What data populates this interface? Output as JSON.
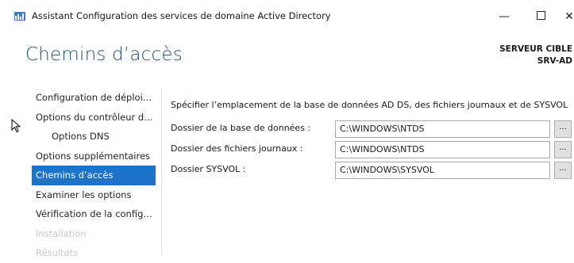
{
  "window": {
    "title": "Assistant Configuration des services de domaine Active Directory",
    "minimize": "—",
    "close": "✕"
  },
  "page": {
    "title": "Chemins d’accès",
    "target_label": "SERVEUR CIBLE",
    "target_name": "SRV-AD"
  },
  "nav": {
    "items": [
      {
        "label": "Configuration de déploie..."
      },
      {
        "label": "Options du contrôleur de..."
      },
      {
        "label": "Options DNS"
      },
      {
        "label": "Options supplémentaires"
      },
      {
        "label": "Chemins d’accès"
      },
      {
        "label": "Examiner les options"
      },
      {
        "label": "Vérification de la configur..."
      },
      {
        "label": "Installation"
      },
      {
        "label": "Résultats"
      }
    ]
  },
  "content": {
    "intro": "Spécifier l’emplacement de la base de données AD DS, des fichiers journaux et de SYSVOL",
    "fields": [
      {
        "label": "Dossier de la base de données :",
        "value": "C:\\WINDOWS\\NTDS",
        "browse": "..."
      },
      {
        "label": "Dossier des fichiers journaux :",
        "value": "C:\\WINDOWS\\NTDS",
        "browse": "..."
      },
      {
        "label": "Dossier SYSVOL :",
        "value": "C:\\WINDOWS\\SYSVOL",
        "browse": "..."
      }
    ]
  },
  "colors": {
    "accent": "#1e73c8",
    "title": "#1e4e79",
    "disabled": "#c8c8c8"
  },
  "icons": {
    "app": "server-manager-icon",
    "cursor": "mouse-pointer-icon"
  }
}
